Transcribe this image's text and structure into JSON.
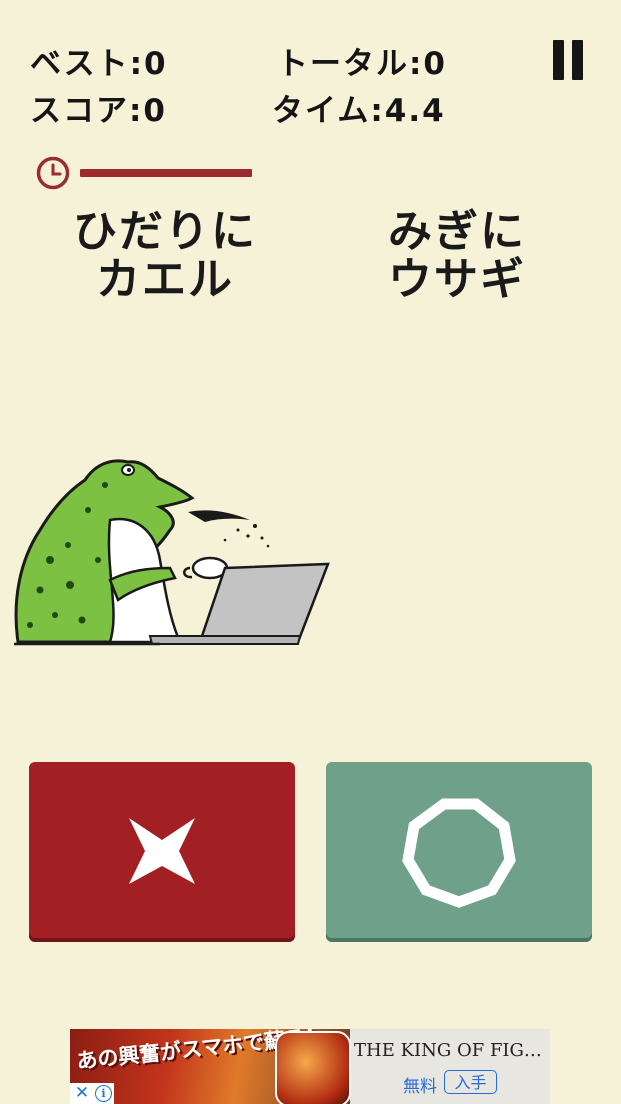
{
  "stats": {
    "best": "ベスト:0",
    "total": "トータル:0",
    "score": "スコア:0",
    "time": "タイム:4.4"
  },
  "timer": {
    "remaining_fraction": 0.9
  },
  "instructions": {
    "left": [
      "ひだりに",
      "カエル"
    ],
    "right": [
      "みぎに",
      "ウサギ"
    ]
  },
  "character": "frog-with-laptop",
  "buttons": {
    "no": {
      "symbol": "×",
      "color": "#a21f23"
    },
    "yes": {
      "symbol": "○",
      "color": "#6ea08a"
    }
  },
  "ad": {
    "banner_text": "あの興奮がスマホで蘇る!",
    "title": "THE KING OF FIGHT…",
    "price": "無料",
    "get": "入手",
    "close": "✕",
    "info": "i"
  },
  "colors": {
    "background": "#f5f2d8",
    "accent_red": "#9c2a2e",
    "accent_green": "#6ea08a"
  }
}
